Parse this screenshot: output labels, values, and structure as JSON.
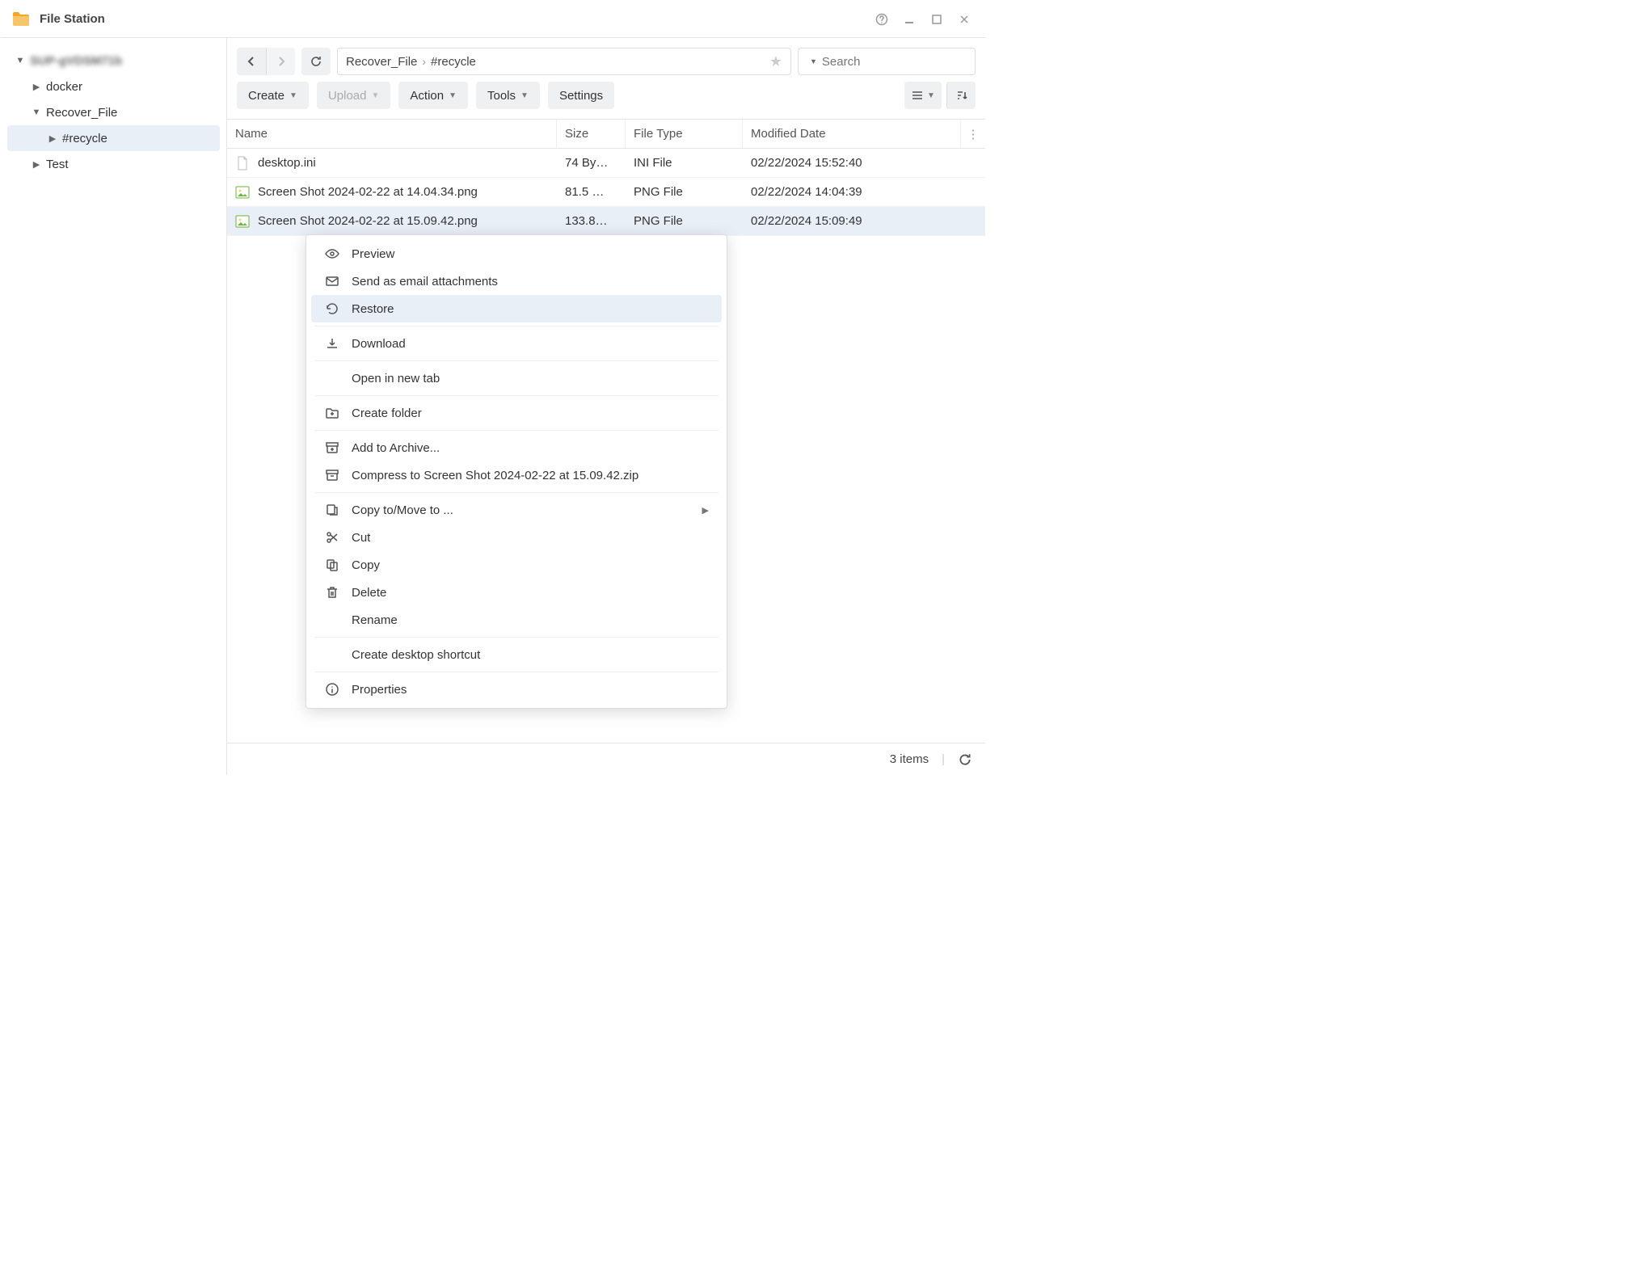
{
  "window": {
    "title": "File Station"
  },
  "sidebar": {
    "root_label": "SUP-gVDSM71b",
    "items": [
      {
        "label": "docker"
      },
      {
        "label": "Recover_File"
      },
      {
        "label": "#recycle"
      },
      {
        "label": "Test"
      }
    ]
  },
  "breadcrumb": {
    "seg0": "Recover_File",
    "seg1": "#recycle"
  },
  "search": {
    "placeholder": "Search"
  },
  "toolbar": {
    "create": "Create",
    "upload": "Upload",
    "action": "Action",
    "tools": "Tools",
    "settings": "Settings"
  },
  "columns": {
    "name": "Name",
    "size": "Size",
    "type": "File Type",
    "date": "Modified Date"
  },
  "rows": [
    {
      "name": "desktop.ini",
      "size": "74 By…",
      "type": "INI File",
      "date": "02/22/2024 15:52:40",
      "icon": "file"
    },
    {
      "name": "Screen Shot 2024-02-22 at 14.04.34.png",
      "size": "81.5 …",
      "type": "PNG File",
      "date": "02/22/2024 14:04:39",
      "icon": "image"
    },
    {
      "name": "Screen Shot 2024-02-22 at 15.09.42.png",
      "size": "133.8…",
      "type": "PNG File",
      "date": "02/22/2024 15:09:49",
      "icon": "image"
    }
  ],
  "context_menu": {
    "preview": "Preview",
    "send_email": "Send as email attachments",
    "restore": "Restore",
    "download": "Download",
    "open_tab": "Open in new tab",
    "create_folder": "Create folder",
    "add_archive": "Add to Archive...",
    "compress": "Compress to Screen Shot 2024-02-22 at 15.09.42.zip",
    "copy_move": "Copy to/Move to ...",
    "cut": "Cut",
    "copy": "Copy",
    "delete": "Delete",
    "rename": "Rename",
    "shortcut": "Create desktop shortcut",
    "properties": "Properties"
  },
  "status": {
    "items": "3 items"
  }
}
